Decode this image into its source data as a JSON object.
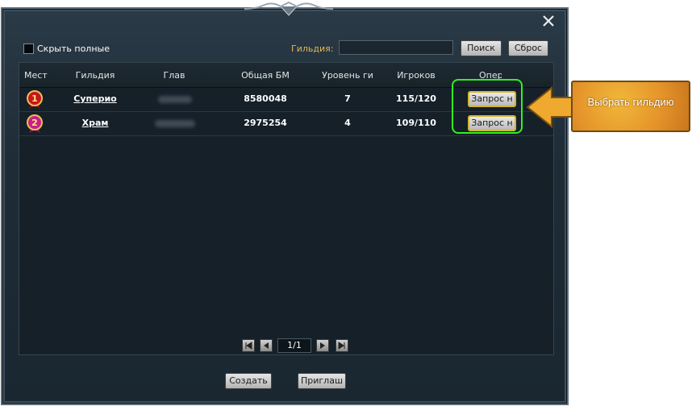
{
  "toolbar": {
    "hide_full_label": "Скрыть полные",
    "guild_label": "Гильдия:",
    "guild_input_value": "",
    "search_label": "Поиск",
    "reset_label": "Сброс"
  },
  "table": {
    "columns": [
      "Мест",
      "Гильдия",
      "Глав",
      "Общая БМ",
      "Уровень ги",
      "Игроков",
      "Опер"
    ],
    "rows": [
      {
        "rank": "1",
        "guild": "Суперио",
        "power": "8580048",
        "level": "7",
        "players": "115/120",
        "action": "Запрос н"
      },
      {
        "rank": "2",
        "guild": "Храм",
        "power": "2975254",
        "level": "4",
        "players": "109/110",
        "action": "Запрос н"
      }
    ]
  },
  "pager": {
    "page": "1/1"
  },
  "footer": {
    "create_label": "Создать",
    "invite_label": "Приглаш"
  },
  "callout": {
    "text": "Выбрать гильдию"
  },
  "colors": {
    "highlight": "#2ef21f",
    "callout": "#e5952a",
    "guild_label": "#e0b558",
    "rank1_medal": "#c8141e",
    "rank2_medal": "#c71f8c",
    "window_bg": "#1e2c37"
  },
  "icons": {
    "close": "close-x-icon",
    "medal_1": "medal-rank-1-icon",
    "medal_2": "medal-rank-2-icon",
    "pager_first": "first-page-icon",
    "pager_prev": "prev-page-icon",
    "pager_next": "next-page-icon",
    "pager_last": "last-page-icon"
  }
}
